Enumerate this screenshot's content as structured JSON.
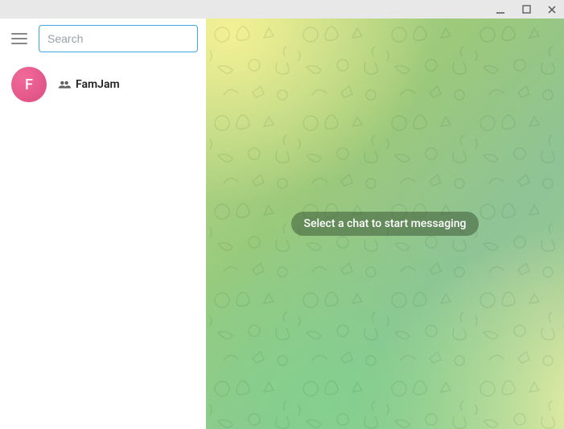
{
  "window": {
    "minimize_label": "Minimize",
    "maximize_label": "Maximize",
    "close_label": "Close"
  },
  "sidebar": {
    "search": {
      "placeholder": "Search",
      "value": ""
    },
    "chats": [
      {
        "avatar_initial": "F",
        "name": "FamJam",
        "type": "group"
      }
    ]
  },
  "chat_area": {
    "empty_message": "Select a chat to start messaging"
  }
}
